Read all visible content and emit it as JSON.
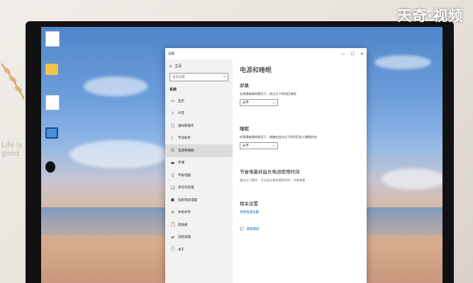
{
  "watermark": "天奇·视频",
  "sidetext": "Life is good",
  "desktop": {
    "icons": [
      {
        "name": "file-icon",
        "label": ""
      },
      {
        "name": "folder-icon",
        "label": ""
      },
      {
        "name": "document-icon",
        "label": ""
      },
      {
        "name": "this-pc-icon",
        "label": ""
      },
      {
        "name": "qq-icon",
        "label": ""
      }
    ]
  },
  "window": {
    "title": "设置",
    "controls": {
      "minimize": "—",
      "maximize": "☐",
      "close": "✕"
    },
    "nav": {
      "home": "主页",
      "search_placeholder": "查找设置",
      "section": "系统",
      "items": [
        {
          "label": "显示",
          "icon": "display-icon",
          "glyph": "▭"
        },
        {
          "label": "声音",
          "icon": "sound-icon",
          "glyph": "♪"
        },
        {
          "label": "通知和操作",
          "icon": "notifications-icon",
          "glyph": "▢"
        },
        {
          "label": "专注助手",
          "icon": "focus-assist-icon",
          "glyph": "☾"
        },
        {
          "label": "电源和睡眠",
          "icon": "power-icon",
          "glyph": "⏻"
        },
        {
          "label": "存储",
          "icon": "storage-icon",
          "glyph": "▬"
        },
        {
          "label": "平板电脑",
          "icon": "tablet-icon",
          "glyph": "▯"
        },
        {
          "label": "多任务处理",
          "icon": "multitasking-icon",
          "glyph": "❏"
        },
        {
          "label": "投影到此电脑",
          "icon": "projecting-icon",
          "glyph": "▣"
        },
        {
          "label": "体验共享",
          "icon": "shared-experiences-icon",
          "glyph": "✕"
        },
        {
          "label": "剪贴板",
          "icon": "clipboard-icon",
          "glyph": "📋"
        },
        {
          "label": "远程桌面",
          "icon": "remote-desktop-icon",
          "glyph": "⇄"
        },
        {
          "label": "关于",
          "icon": "about-icon",
          "glyph": "ⓘ"
        }
      ],
      "active_index": 4
    },
    "content": {
      "title": "电源和睡眠",
      "screen": {
        "heading": "屏幕",
        "desc": "在接通电源的情况下，经过以下时间后关闭",
        "value": "从不"
      },
      "sleep": {
        "heading": "睡眠",
        "desc": "在接通电源的情况下，电脑在经过以下时间后进入睡眠状态",
        "value": "从不"
      },
      "save": {
        "heading": "节省电量并延长电池使用时间",
        "desc": "通过以下操作，可以延长电池使用时间，节省电量"
      },
      "related": {
        "heading": "相关设置",
        "link": "其他电源设置"
      },
      "help": "获取帮助"
    }
  }
}
